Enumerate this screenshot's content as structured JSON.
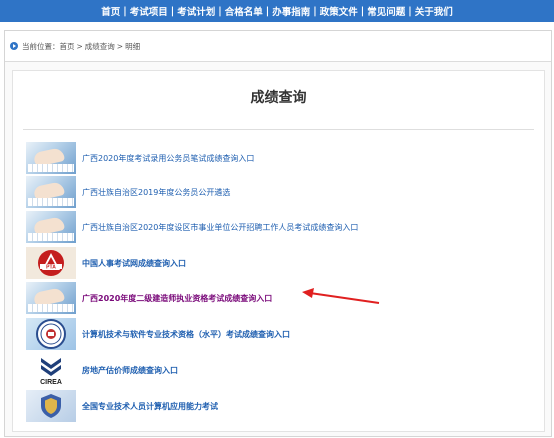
{
  "topnav": {
    "items": [
      "首页",
      "考试项目",
      "考试计划",
      "合格名单",
      "办事指南",
      "政策文件",
      "常见问题",
      "关于我们"
    ],
    "separator": "|"
  },
  "breadcrumb": {
    "label": "当前位置：",
    "path": [
      "首页",
      "成绩查询",
      "明细"
    ],
    "separator": ">"
  },
  "card": {
    "title": "成绩查询"
  },
  "links": [
    {
      "label": "广西2020年度考试录用公务员笔试成绩查询入口",
      "icon": "keyboard-photo-icon"
    },
    {
      "label": "广西壮族自治区2019年度公务员公开遴选",
      "icon": "keyboard-photo-icon"
    },
    {
      "label": "广西壮族自治区2020年度设区市事业单位公开招聘工作人员考试成绩查询入口",
      "icon": "keyboard-photo-icon"
    },
    {
      "label": "中国人事考试网成绩查询入口",
      "icon": "pta-logo-icon"
    },
    {
      "label": "广西2020年度二级建造师执业资格考试成绩查询入口",
      "icon": "keyboard-photo-icon"
    },
    {
      "label": "计算机技术与软件专业技术资格（水平）考试成绩查询入口",
      "icon": "round-seal-logo-icon"
    },
    {
      "label": "房地产估价师成绩查询入口",
      "icon": "cirea-logo-icon"
    },
    {
      "label": "全国专业技术人员计算机应用能力考试",
      "icon": "shield-logo-icon"
    }
  ],
  "logos": {
    "pta": "PTA",
    "cirea": "CIREA"
  },
  "colors": {
    "nav": "#2f74c6",
    "link": "#1f5fb0",
    "highlight": "#7a0a7a",
    "arrow": "#e02020"
  }
}
